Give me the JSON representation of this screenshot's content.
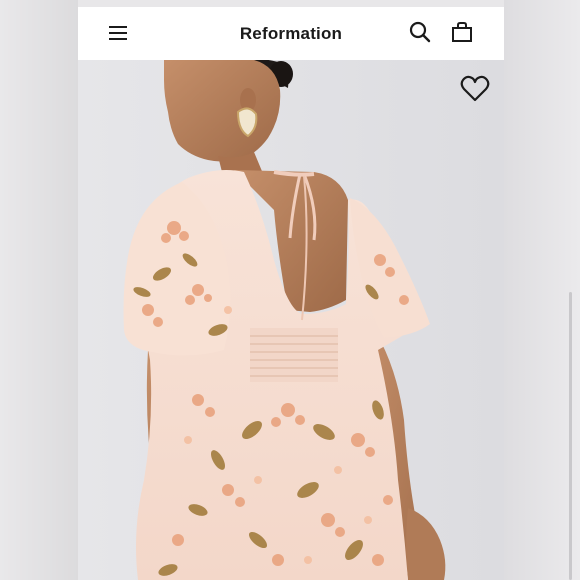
{
  "header": {
    "brand": "Reformation",
    "menu_icon": "menu-icon",
    "search_icon": "search-icon",
    "bag_icon": "shopping-bag-icon"
  },
  "product": {
    "image": "product-image",
    "favorite_icon": "heart-icon"
  },
  "colors": {
    "header_bg": "#ffffff",
    "page_bg": "#e3e3e6",
    "dress_base": "#f6ded2",
    "floral_orange": "#e79a6e",
    "floral_brown": "#a07a3c",
    "skin": "#b9805c"
  }
}
